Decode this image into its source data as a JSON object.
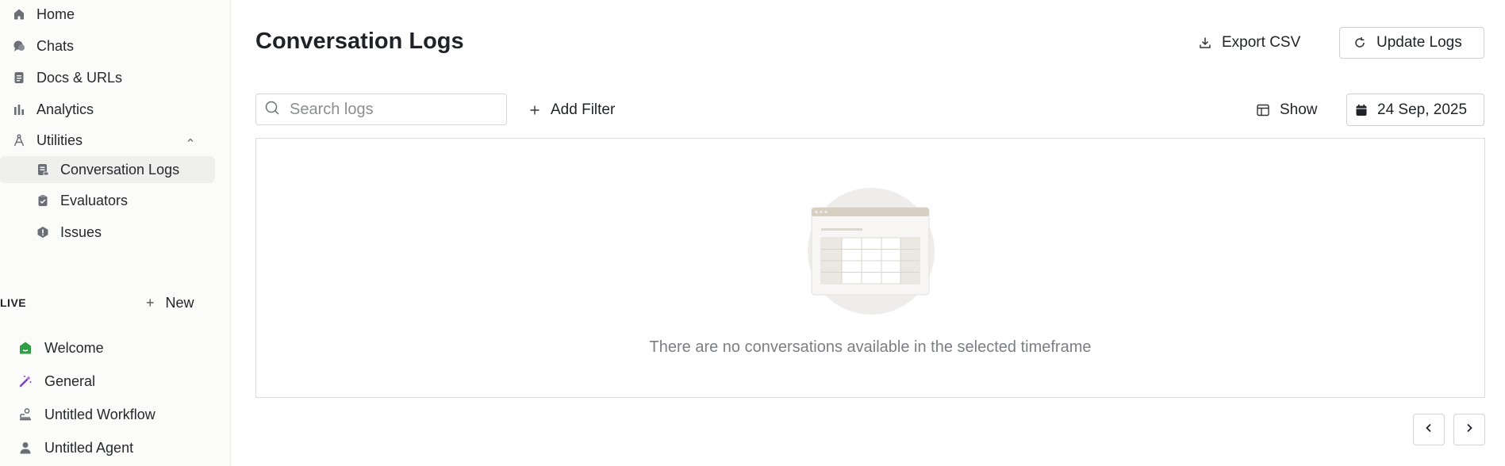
{
  "sidebar": {
    "items": [
      {
        "label": "Home",
        "icon": "home-icon"
      },
      {
        "label": "Chats",
        "icon": "chat-icon"
      },
      {
        "label": "Docs & URLs",
        "icon": "document-icon"
      },
      {
        "label": "Analytics",
        "icon": "bar-chart-icon"
      },
      {
        "label": "Utilities",
        "icon": "compass-icon",
        "expanded": true
      }
    ],
    "sub_items": [
      {
        "label": "Conversation Logs",
        "icon": "log-icon",
        "active": true
      },
      {
        "label": "Evaluators",
        "icon": "clipboard-icon"
      },
      {
        "label": "Issues",
        "icon": "alert-icon"
      }
    ],
    "live": {
      "label": "LIVE",
      "new_label": "New",
      "agents": [
        {
          "label": "Welcome",
          "icon": "house-icon",
          "color": "#2f9e44"
        },
        {
          "label": "General",
          "icon": "magic-wand-icon",
          "color": "#7e3bc6"
        },
        {
          "label": "Untitled Workflow",
          "icon": "workflow-icon",
          "color": "#6b6f75"
        },
        {
          "label": "Untitled Agent",
          "icon": "person-icon",
          "color": "#6b6f75"
        }
      ]
    }
  },
  "main": {
    "title": "Conversation Logs",
    "export_label": "Export CSV",
    "update_label": "Update Logs",
    "search_placeholder": "Search logs",
    "add_filter_label": "Add Filter",
    "show_label": "Show",
    "date_label": "24 Sep, 2025",
    "empty_message": "There are no conversations available in the selected timeframe"
  }
}
